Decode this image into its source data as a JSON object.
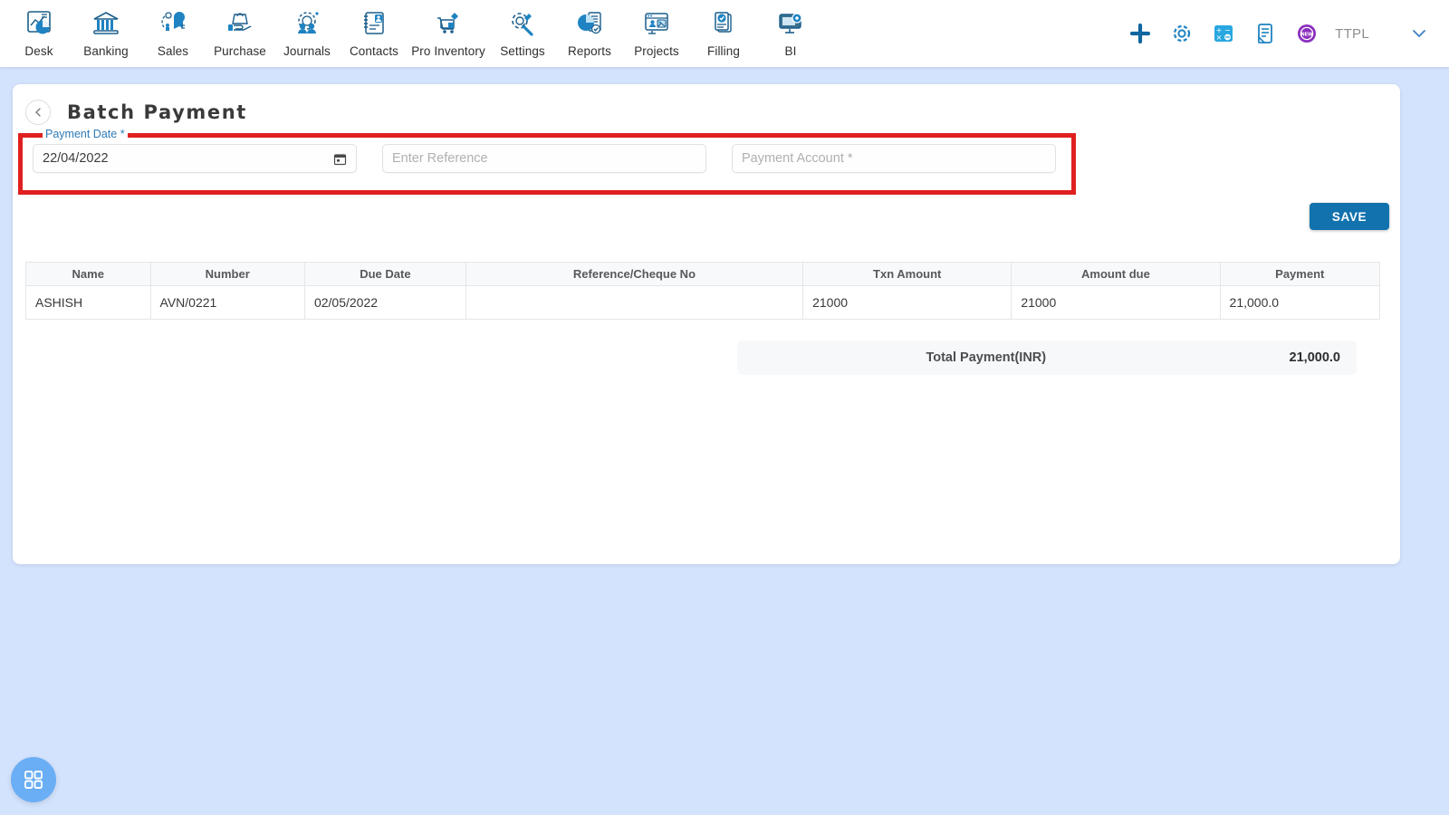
{
  "topnav": {
    "modules": [
      {
        "label": "Desk",
        "icon": "dashboard-chart-icon"
      },
      {
        "label": "Banking",
        "icon": "bank-building-icon"
      },
      {
        "label": "Sales",
        "icon": "sales-megaphone-icon"
      },
      {
        "label": "Purchase",
        "icon": "purchase-hand-bag-icon"
      },
      {
        "label": "Journals",
        "icon": "journals-gear-people-icon"
      },
      {
        "label": "Contacts",
        "icon": "contacts-notebook-icon"
      },
      {
        "label": "Pro Inventory",
        "icon": "inventory-cart-icon"
      },
      {
        "label": "Settings",
        "icon": "settings-gear-wrench-icon"
      },
      {
        "label": "Reports",
        "icon": "reports-piechart-doc-icon"
      },
      {
        "label": "Projects",
        "icon": "projects-browser-icon"
      },
      {
        "label": "Filling",
        "icon": "filling-check-doc-icon"
      },
      {
        "label": "BI",
        "icon": "bi-monitor-gear-icon"
      }
    ],
    "actions": [
      {
        "name": "add-new-icon",
        "icon": "plus-icon"
      },
      {
        "name": "settings-icon",
        "icon": "gear-icon"
      },
      {
        "name": "calculator-icon",
        "icon": "calculator-icon"
      },
      {
        "name": "notes-icon",
        "icon": "document-notes-icon"
      },
      {
        "name": "whats-new-icon",
        "icon": "new-badge-icon"
      }
    ],
    "org_name": "TTPL",
    "org_caret": "chevron-down-icon"
  },
  "page": {
    "back_icon": "chevron-left-icon",
    "title": "Batch Payment"
  },
  "form": {
    "payment_date": {
      "label": "Payment Date",
      "required_mark": "*",
      "value": "22/04/2022",
      "icon": "calendar-icon"
    },
    "reference": {
      "placeholder": "Enter Reference",
      "value": ""
    },
    "payment_account": {
      "placeholder": "Payment Account *",
      "value": ""
    },
    "highlight_color": "#e02020"
  },
  "toolbar": {
    "save_label": "SAVE",
    "save_color": "#1272ad"
  },
  "table": {
    "columns": [
      "Name",
      "Number",
      "Due Date",
      "Reference/Cheque No",
      "Txn Amount",
      "Amount due",
      "Payment"
    ],
    "rows": [
      {
        "name": "ASHISH",
        "number": "AVN/0221",
        "due_date": "02/05/2022",
        "reference": "",
        "txn_amount": "21000",
        "amount_due": "21000",
        "payment": "21,000.0"
      }
    ]
  },
  "totals": {
    "label": "Total Payment(INR)",
    "value": "21,000.0"
  },
  "fab": {
    "icon": "apps-grid-icon"
  },
  "theme": {
    "page_background": "#d3e3fd",
    "card_background": "#ffffff",
    "accent_blue": "#1272ad",
    "label_blue": "#2f7ab5",
    "fab_blue": "#6aaef5"
  }
}
